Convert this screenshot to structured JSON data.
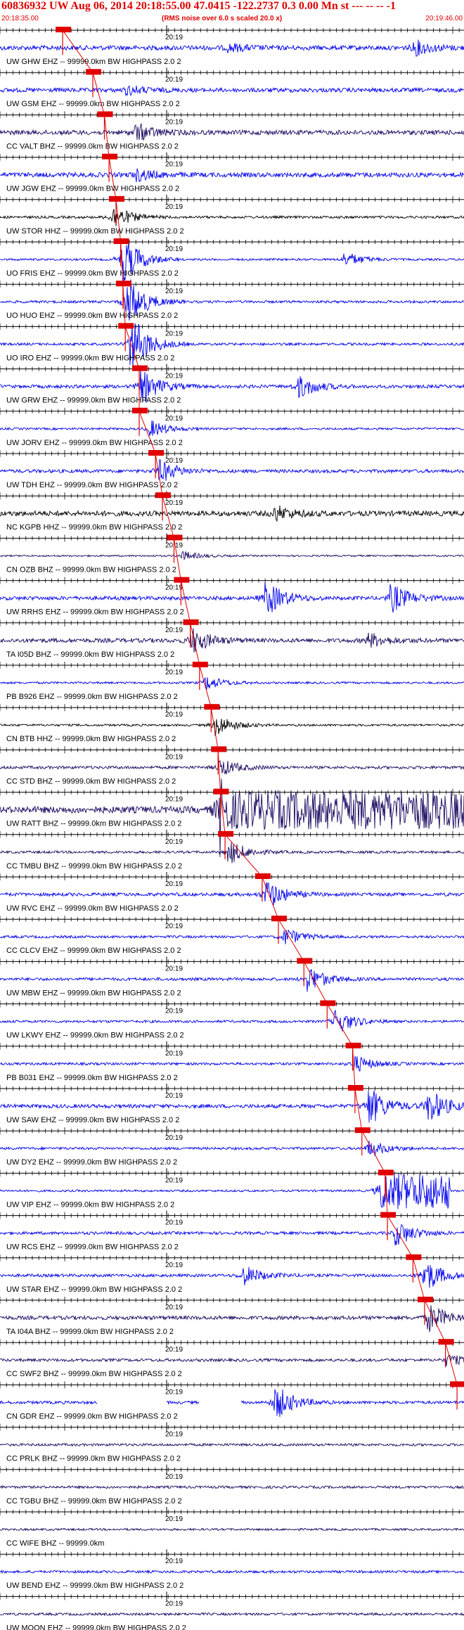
{
  "header": {
    "title": "60836932 UW Aug 06, 2014 20:18:55.00   47.0415 -122.2737  0.3 0.00 Mn st --- -- --  -1",
    "start_time": "20:18:35.00",
    "rms_note": "(RMS noise over 6.0 s scaled 20.0 x)",
    "end_time": "20:19:46.00"
  },
  "minute_label": "20:19",
  "colors": {
    "accent": "#e00000",
    "trace_blue": "#0000ee",
    "trace_navy": "#1a0860",
    "trace_black": "#000000",
    "pick_box": "#e00000"
  },
  "stations": [
    {
      "label": "UW GHW EHZ -- 99999.0km BW  HIGHPASS  2.0  2",
      "color": "blue",
      "pick": 0.135,
      "amp": 0.55,
      "burst": [
        0.5,
        0.25
      ],
      "burst2": [
        0.9,
        0.5
      ]
    },
    {
      "label": "UW GSM EHZ -- 99999.0km BW  HIGHPASS  2.0  2",
      "color": "blue",
      "pick": 0.2,
      "amp": 0.5,
      "burst": [
        0.28,
        0.3
      ]
    },
    {
      "label": "CC VALT BHZ -- 99999.0km BW  HIGHPASS  2.0  2",
      "color": "navy",
      "pick": 0.225,
      "amp": 0.55,
      "burst": [
        0.3,
        0.6
      ]
    },
    {
      "label": "UW JGW EHZ -- 99999.0km BW  HIGHPASS  2.0  2",
      "color": "blue",
      "pick": 0.235,
      "amp": 0.55,
      "burst": [
        0.3,
        0.4
      ]
    },
    {
      "label": "UW STOR HHZ -- 99999.0km BW  HIGHPASS  2.0  2",
      "color": "black",
      "pick": 0.25,
      "amp": 0.3,
      "burst": [
        0.25,
        0.8
      ]
    },
    {
      "label": "UO FRIS EHZ -- 99999.0km BW  HIGHPASS  2.0  2",
      "color": "blue",
      "pick": 0.26,
      "amp": 0.25,
      "burst": [
        0.27,
        1.8
      ],
      "burst2": [
        0.75,
        0.5
      ]
    },
    {
      "label": "UO HUO EHZ -- 99999.0km BW  HIGHPASS  2.0  2",
      "color": "blue",
      "pick": 0.265,
      "amp": 0.3,
      "burst": [
        0.28,
        1.8
      ]
    },
    {
      "label": "UO IRO EHZ -- 99999.0km BW  HIGHPASS  2.0  2",
      "color": "blue",
      "pick": 0.27,
      "amp": 0.3,
      "burst": [
        0.29,
        2.0
      ]
    },
    {
      "label": "UW GRW EHZ -- 99999.0km BW  HIGHPASS  2.0  2",
      "color": "blue",
      "pick": 0.3,
      "amp": 0.4,
      "burst": [
        0.31,
        1.2
      ],
      "burst2": [
        0.65,
        0.8
      ]
    },
    {
      "label": "UW JORV EHZ -- 99999.0km BW  HIGHPASS  2.0  2",
      "color": "blue",
      "pick": 0.3,
      "amp": 0.25,
      "burst": [
        0.33,
        0.6
      ]
    },
    {
      "label": "UW TDH EHZ -- 99999.0km BW  HIGHPASS  2.0  2",
      "color": "blue",
      "pick": 0.335,
      "amp": 0.4,
      "burst": [
        0.35,
        0.8
      ]
    },
    {
      "label": "NC KGPB HHZ -- 99999.0km BW  HIGHPASS  2.0  2",
      "color": "black",
      "pick": 0.35,
      "amp": 0.6,
      "burst": [
        0.6,
        0.5
      ]
    },
    {
      "label": "CN OZB BHZ -- 99999.0km BW  HIGHPASS  2.0  2",
      "color": "navy",
      "pick": 0.375,
      "amp": 0.2,
      "burst": [
        0.4,
        0.3
      ]
    },
    {
      "label": "UW RRHS EHZ -- 99999.0km BW  HIGHPASS  2.0  2",
      "color": "blue",
      "pick": 0.39,
      "amp": 0.45,
      "burst": [
        0.58,
        1.2
      ],
      "burst2": [
        0.85,
        1.0
      ]
    },
    {
      "label": "TA I05D BHZ -- 99999.0km BW  HIGHPASS  2.0  2",
      "color": "navy",
      "pick": 0.41,
      "amp": 0.5,
      "burst": [
        0.42,
        0.9
      ],
      "burst2": [
        0.8,
        0.5
      ]
    },
    {
      "label": "PB B926 EHZ -- 99999.0km BW  HIGHPASS  2.0  2",
      "color": "blue",
      "pick": 0.43,
      "amp": 0.25,
      "burst": [
        0.45,
        0.5
      ]
    },
    {
      "label": "CN BTB HHZ -- 99999.0km BW  HIGHPASS  2.0  2",
      "color": "black",
      "pick": 0.455,
      "amp": 0.25,
      "burst": [
        0.47,
        0.8
      ]
    },
    {
      "label": "CC STD BHZ -- 99999.0km BW  HIGHPASS  2.0  2",
      "color": "navy",
      "pick": 0.47,
      "amp": 0.35,
      "burst": [
        0.48,
        0.6
      ]
    },
    {
      "label": "UW RATT BHZ -- 99999.0km BW  HIGHPASS  2.0  2",
      "color": "navy",
      "pick": 0.475,
      "amp": 0.8,
      "burst": [
        0.48,
        3.5
      ],
      "saturate": true
    },
    {
      "label": "CC TMBU BHZ -- 99999.0km BW  HIGHPASS  2.0  2",
      "color": "navy",
      "pick": 0.485,
      "amp": 0.3,
      "burst": [
        0.5,
        0.8
      ]
    },
    {
      "label": "UW RVC EHZ -- 99999.0km BW  HIGHPASS  2.0  2",
      "color": "blue",
      "pick": 0.565,
      "amp": 0.4,
      "burst": [
        0.58,
        1.0
      ]
    },
    {
      "label": "CC CLCV EHZ -- 99999.0km BW  HIGHPASS  2.0  2",
      "color": "blue",
      "pick": 0.6,
      "amp": 0.3,
      "burst": [
        0.62,
        0.6
      ]
    },
    {
      "label": "UW MBW EHZ -- 99999.0km BW  HIGHPASS  2.0  2",
      "color": "blue",
      "pick": 0.655,
      "amp": 0.35,
      "burst": [
        0.67,
        0.9
      ]
    },
    {
      "label": "UW LKWY EHZ -- 99999.0km BW  HIGHPASS  2.0  2",
      "color": "blue",
      "pick": 0.705,
      "amp": 0.3,
      "burst": [
        0.73,
        0.9
      ]
    },
    {
      "label": "PB B031 EHZ -- 99999.0km BW  HIGHPASS  2.0  2",
      "color": "blue",
      "pick": 0.76,
      "amp": 0.3,
      "burst": [
        0.77,
        0.6
      ]
    },
    {
      "label": "UW SAW EHZ -- 99999.0km BW  HIGHPASS  2.0  2",
      "color": "blue",
      "pick": 0.765,
      "amp": 0.45,
      "burst": [
        0.8,
        1.4
      ],
      "burst2": [
        0.93,
        1.2
      ]
    },
    {
      "label": "UW DY2 EHZ -- 99999.0km BW  HIGHPASS  2.0  2",
      "color": "blue",
      "pick": 0.78,
      "amp": 0.3,
      "burst": [
        0.8,
        0.6
      ]
    },
    {
      "label": "UW VIP EHZ -- 99999.0km BW  HIGHPASS  2.0  2",
      "color": "blue",
      "pick": 0.83,
      "amp": 0.25,
      "burst": [
        0.83,
        2.5
      ],
      "clipblock": true
    },
    {
      "label": "UW RCS EHZ -- 99999.0km BW  HIGHPASS  2.0  2",
      "color": "blue",
      "pick": 0.835,
      "amp": 0.35,
      "burst": [
        0.86,
        0.9
      ]
    },
    {
      "label": "UW STAR EHZ -- 99999.0km BW  HIGHPASS  2.0  2",
      "color": "blue",
      "pick": 0.89,
      "amp": 0.35,
      "burst": [
        0.92,
        1.2
      ],
      "burst2": [
        0.53,
        0.7
      ]
    },
    {
      "label": "TA I04A BHZ -- 99999.0km BW  HIGHPASS  2.0  2",
      "color": "navy",
      "pick": 0.915,
      "amp": 0.45,
      "burst": [
        0.93,
        1.0
      ]
    },
    {
      "label": "CC SWF2 BHZ -- 99999.0km BW  HIGHPASS  2.0  2",
      "color": "navy",
      "pick": 0.96,
      "amp": 0.35,
      "burst": [
        0.97,
        0.4
      ]
    },
    {
      "label": "CN GDR EHZ -- 99999.0km BW  HIGHPASS  2.0  2",
      "color": "blue",
      "pick": 0.985,
      "amp": 0.35,
      "burst": [
        0.6,
        1.2
      ],
      "gaps": true
    },
    {
      "label": "CC PRLK BHZ -- 99999.0km BW  HIGHPASS  2.0  2",
      "color": "navy",
      "pick": -1,
      "amp": 0.3
    },
    {
      "label": "CC TGBU BHZ -- 99999.0km BW  HIGHPASS  2.0  2",
      "color": "navy",
      "pick": -1,
      "amp": 0.3
    },
    {
      "label": "CC WIFE BHZ -- 99999.0km",
      "color": "navy",
      "pick": -1,
      "amp": 0.25
    },
    {
      "label": "UW BEND EHZ -- 99999.0km BW  HIGHPASS  2.0  2",
      "color": "blue",
      "pick": -1,
      "amp": 0.3
    },
    {
      "label": "UW MOON EHZ -- 99999.0km BW  HIGHPASS  2.0  2",
      "color": "navy",
      "pick": -1,
      "amp": 0.3
    }
  ]
}
